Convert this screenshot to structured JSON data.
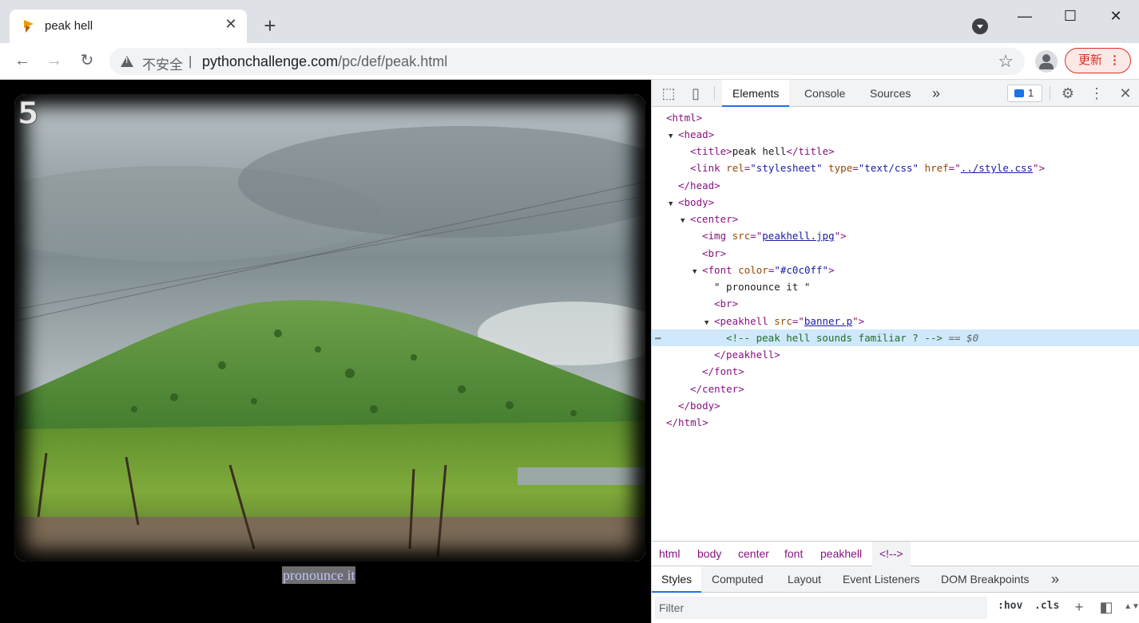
{
  "tab": {
    "title": "peak hell",
    "close": "✕"
  },
  "window": {
    "minimize": "—",
    "maximize": "☐",
    "close": "✕"
  },
  "toolbar": {
    "back": "←",
    "forward": "→",
    "reload": "↻",
    "security_label": "不安全",
    "separator": "|",
    "url_domain": "pythonchallenge.com",
    "url_path": "/pc/def/peak.html",
    "update_label": "更新"
  },
  "page": {
    "level_number": "5",
    "caption": "pronounce it"
  },
  "devtools": {
    "tabs": [
      "Elements",
      "Console",
      "Sources"
    ],
    "more_tabs": "»",
    "issues_count": "1",
    "dom": {
      "l1": "<html>",
      "l2": "<head>",
      "l3_tag_open": "<title>",
      "l3_text": "peak hell",
      "l3_tag_close": "</title>",
      "l4_tag": "<link",
      "l4_a1": "rel",
      "l4_v1": "\"stylesheet\"",
      "l4_a2": "type",
      "l4_v2": "\"text/css\"",
      "l4_a3": "href",
      "l4_v3": "../style.css",
      "l5": "</head>",
      "l6": "<body>",
      "l7": "<center>",
      "l8_tag": "<img",
      "l8_a": "src",
      "l8_v": "peakhell.jpg",
      "l9": "<br>",
      "l10_tag": "<font",
      "l10_a": "color",
      "l10_v": "\"#c0c0ff\"",
      "l11": "\" pronounce it \"",
      "l12": "<br>",
      "l13_tag": "<peakhell",
      "l13_a": "src",
      "l13_v": "banner.p",
      "l14_comment": "<!-- peak hell sounds familiar ? -->",
      "l14_ref": "== $0",
      "l15": "</peakhell>",
      "l16": "</font>",
      "l17": "</center>",
      "l18": "</body>",
      "l19": "</html>"
    },
    "breadcrumbs": [
      "html",
      "body",
      "center",
      "font",
      "peakhell",
      "<!-->"
    ],
    "subtabs": [
      "Styles",
      "Computed",
      "Layout",
      "Event Listeners",
      "DOM Breakpoints"
    ],
    "filter_placeholder": "Filter",
    "hov": ":hov",
    "cls": ".cls"
  }
}
